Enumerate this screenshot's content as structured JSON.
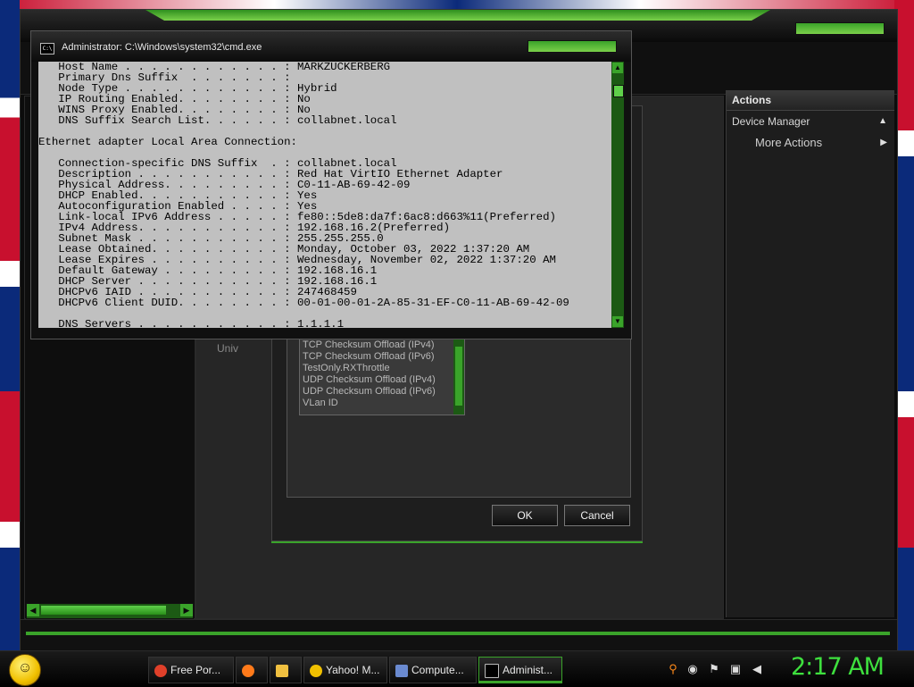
{
  "mmc": {
    "actions_header": "Actions",
    "actions": [
      {
        "label": "Device Manager",
        "arrow": "▲"
      },
      {
        "label": "More Actions",
        "arrow": "▶"
      }
    ],
    "tree_partial": "Univ"
  },
  "dialog": {
    "properties": [
      "TCP Checksum Offload (IPv4)",
      "TCP Checksum Offload (IPv6)",
      "TestOnly.RXThrottle",
      "UDP Checksum Offload (IPv4)",
      "UDP Checksum Offload (IPv6)",
      "VLan ID"
    ],
    "ok_label": "OK",
    "cancel_label": "Cancel"
  },
  "cmd": {
    "title": "Administrator: C:\\Windows\\system32\\cmd.exe",
    "icon_text": "C:\\",
    "lines": [
      "   Host Name . . . . . . . . . . . . : MARKZUCKERBERG",
      "   Primary Dns Suffix  . . . . . . . :",
      "   Node Type . . . . . . . . . . . . : Hybrid",
      "   IP Routing Enabled. . . . . . . . : No",
      "   WINS Proxy Enabled. . . . . . . . : No",
      "   DNS Suffix Search List. . . . . . : collabnet.local",
      "",
      "Ethernet adapter Local Area Connection:",
      "",
      "   Connection-specific DNS Suffix  . : collabnet.local",
      "   Description . . . . . . . . . . . : Red Hat VirtIO Ethernet Adapter",
      "   Physical Address. . . . . . . . . : C0-11-AB-69-42-09",
      "   DHCP Enabled. . . . . . . . . . . : Yes",
      "   Autoconfiguration Enabled . . . . : Yes",
      "   Link-local IPv6 Address . . . . . : fe80::5de8:da7f:6ac8:d663%11(Preferred)",
      "   IPv4 Address. . . . . . . . . . . : 192.168.16.2(Preferred)",
      "   Subnet Mask . . . . . . . . . . . : 255.255.255.0",
      "   Lease Obtained. . . . . . . . . . : Monday, October 03, 2022 1:37:20 AM",
      "   Lease Expires . . . . . . . . . . : Wednesday, November 02, 2022 1:37:20 AM",
      "   Default Gateway . . . . . . . . . : 192.168.16.1",
      "   DHCP Server . . . . . . . . . . . : 192.168.16.1",
      "   DHCPv6 IAID . . . . . . . . . . . : 247468459",
      "   DHCPv6 Client DUID. . . . . . . . : 00-01-00-01-2A-85-31-EF-C0-11-AB-69-42-09",
      "",
      "   DNS Servers . . . . . . . . . . . : 1.1.1.1"
    ]
  },
  "taskbar": {
    "items": [
      {
        "label": "Free Por...",
        "icon": "chrome-icon",
        "color": "#e0402a"
      },
      {
        "label": "",
        "icon": "firefox-icon",
        "color": "#ff7a1a"
      },
      {
        "label": "",
        "icon": "folder-icon",
        "color": "#f0c040"
      },
      {
        "label": "Yahoo! M...",
        "icon": "yahoo-messenger-icon",
        "color": "#f0c000"
      },
      {
        "label": "Compute...",
        "icon": "computer-management-icon",
        "color": "#6a8ad0"
      },
      {
        "label": "Administ...",
        "icon": "cmd-icon",
        "color": "#000000"
      }
    ],
    "clock": "2:17 AM"
  },
  "colors": {
    "accent_green": "#3aa32a",
    "clock_green": "#3ee03e",
    "cmd_background": "#c0c0c0"
  }
}
